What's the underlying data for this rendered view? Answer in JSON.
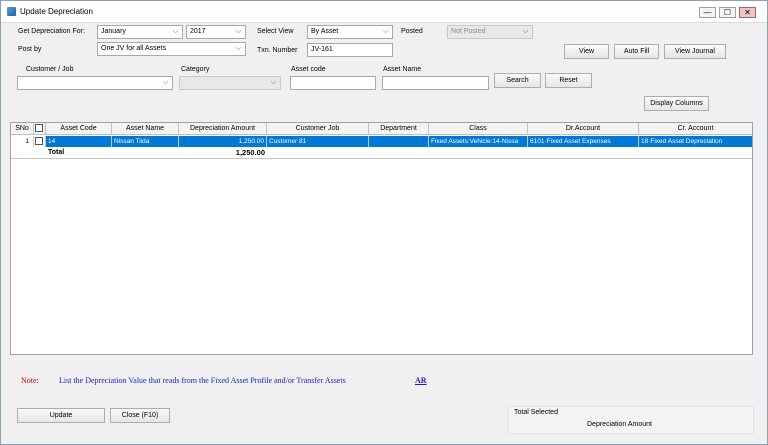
{
  "window": {
    "title": "Update Depreciation",
    "controls": [
      "—",
      "☐",
      "✕"
    ]
  },
  "filters": {
    "get_for_label": "Get Depreciation For:",
    "month": "January",
    "year": "2017",
    "select_view_label": "Select View",
    "select_view": "By Asset",
    "posted_label": "Posted",
    "posted": "Not Posted",
    "post_by_label": "Post by",
    "post_by": "One JV for all Assets",
    "txn_label": "Txn. Number",
    "txn_number": "JV-161",
    "customer_label": "Customer / Job",
    "customer": "",
    "category_label": "Category",
    "category": "",
    "asset_code_label": "Asset code",
    "asset_code": "",
    "asset_name_label": "Asset Name",
    "asset_name": ""
  },
  "buttons": {
    "view": "View",
    "auto_fill": "Auto Fill",
    "view_journal": "View Journal",
    "search": "Search",
    "reset": "Reset",
    "display_columns": "Display Columns",
    "update": "Update",
    "close": "Close (F10)"
  },
  "grid": {
    "columns": [
      "SNo",
      "",
      "Asset Code",
      "Asset Name",
      "Depreciation Amount",
      "Customer Job",
      "Department",
      "Class",
      "Dr.Account",
      "Cr. Account"
    ],
    "rows": [
      {
        "sno": "1",
        "asset_code": "14",
        "asset_name": "Nissan Tiida",
        "depreciation_amount": "1,250.00",
        "customer_job": "Customer 81",
        "department": "",
        "class": "Fixed Assets:Vehicle:14-Nissa",
        "dr_account": "6101·Fixed Asset Expenses",
        "cr_account": "18·Fixed Asset Depreciation"
      }
    ],
    "total_label": "Total",
    "total_amount": "1,250.00"
  },
  "note": {
    "label": "Note:",
    "text": "List the Depreciation Value that reads from the Fixed Asset Profile and/or Transfer Assets",
    "link": "AR"
  },
  "summary": {
    "title": "Total Selected",
    "subtitle": "Depreciation Amount"
  }
}
